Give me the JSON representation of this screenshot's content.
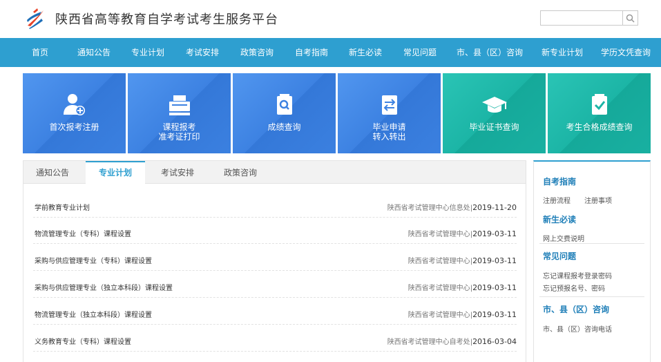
{
  "header": {
    "title": "陕西省高等教育自学考试考生服务平台",
    "search_placeholder": ""
  },
  "nav": [
    {
      "label": "首页"
    },
    {
      "label": "通知公告"
    },
    {
      "label": "专业计划"
    },
    {
      "label": "考试安排"
    },
    {
      "label": "政策咨询"
    },
    {
      "label": "自考指南"
    },
    {
      "label": "新生必读"
    },
    {
      "label": "常见问题"
    },
    {
      "label": "市、县（区）咨询"
    },
    {
      "label": "新专业计划"
    },
    {
      "label": "学历文凭查询"
    }
  ],
  "tiles": [
    {
      "line1": "首次报考注册",
      "line2": "",
      "icon": "user-plus-icon"
    },
    {
      "line1": "课程报考",
      "line2": "准考证打印",
      "icon": "printer-icon"
    },
    {
      "line1": "成绩查询",
      "line2": "",
      "icon": "search-doc-icon"
    },
    {
      "line1": "毕业申请",
      "line2": "转入转出",
      "icon": "transfer-icon"
    },
    {
      "line1": "毕业证书查询",
      "line2": "",
      "icon": "graduation-cap-icon"
    },
    {
      "line1": "考生合格成绩查询",
      "line2": "",
      "icon": "check-clipboard-icon"
    }
  ],
  "tabs": [
    {
      "label": "通知公告"
    },
    {
      "label": "专业计划"
    },
    {
      "label": "考试安排"
    },
    {
      "label": "政策咨询"
    }
  ],
  "list": [
    {
      "title": "学前教育专业计划",
      "source": "陕西省考试管理中心信息处",
      "date": "2019-11-20"
    },
    {
      "title": "物流管理专业（专科）课程设置",
      "source": "陕西省考试管理中心",
      "date": "2019-03-11"
    },
    {
      "title": "采购与供应管理专业（专科）课程设置",
      "source": "陕西省考试管理中心",
      "date": "2019-03-11"
    },
    {
      "title": "采购与供应管理专业（独立本科段）课程设置",
      "source": "陕西省考试管理中心",
      "date": "2019-03-11"
    },
    {
      "title": "物流管理专业（独立本科段）课程设置",
      "source": "陕西省考试管理中心",
      "date": "2019-03-11"
    },
    {
      "title": "义务教育专业（专科）课程设置",
      "source": "陕西省考试管理中心自考处",
      "date": "2016-03-04"
    }
  ],
  "sidebar": {
    "guide_title": "自考指南",
    "guide_link1": "注册流程",
    "guide_link2": "注册事项",
    "newbie_title": "新生必读",
    "newbie_link1": "网上交费说明",
    "faq_title": "常见问题",
    "faq_link1": "忘记课程报考登录密码",
    "faq_link2": "忘记预报名号、密码",
    "county_title": "市、县（区）咨询",
    "county_link1": "市、县（区）咨询电话"
  },
  "colors": {
    "nav_bg": "#2e9fd0",
    "tile_blue": "#3f86e6",
    "tile_teal": "#1cb5a6"
  }
}
